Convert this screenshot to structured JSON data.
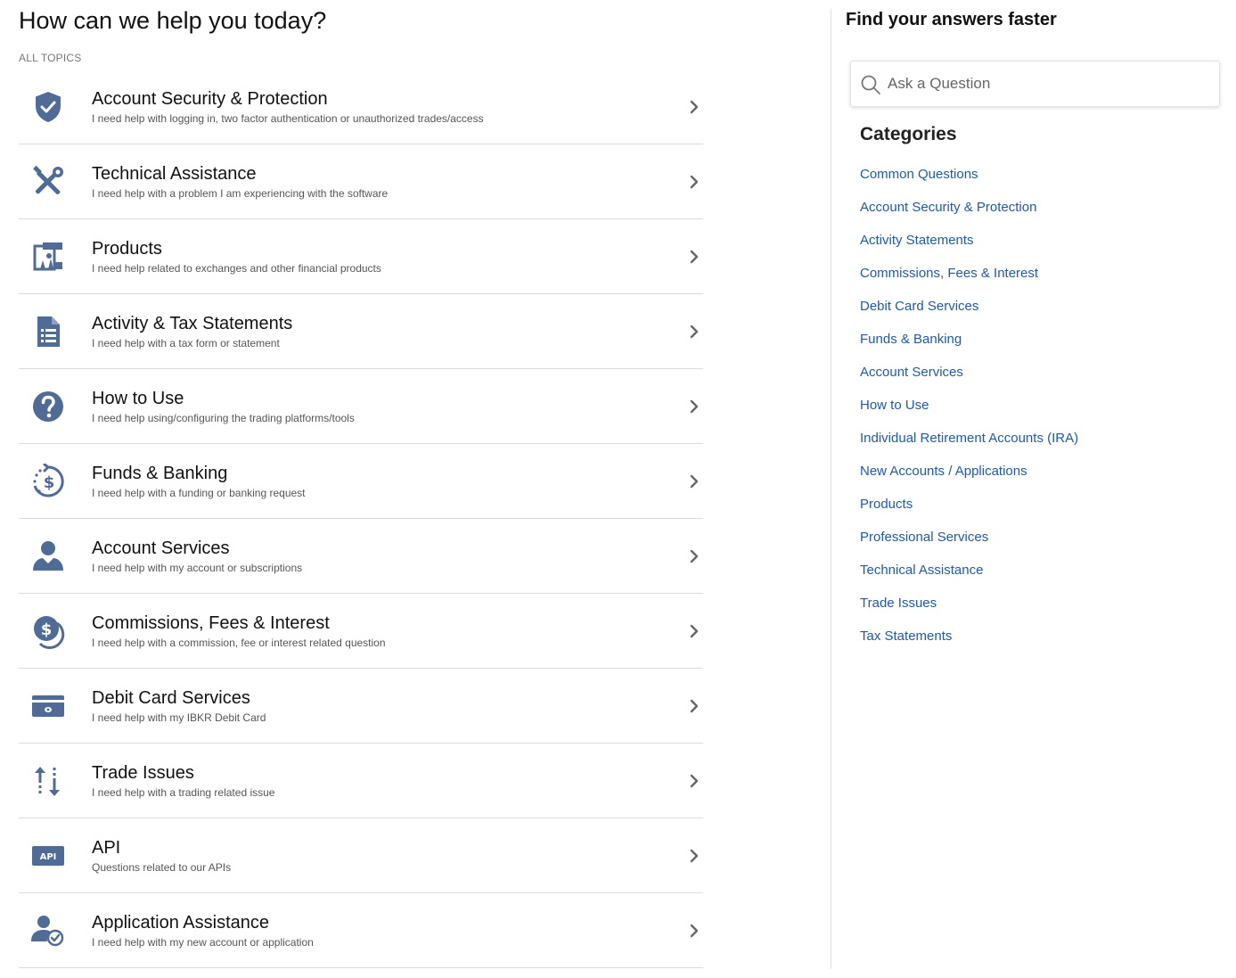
{
  "header": {
    "title": "How can we help you today?",
    "all_topics_label": "ALL TOPICS"
  },
  "colors": {
    "icon": "#4f6b96",
    "link": "#1f5aa8",
    "chevron": "#666666"
  },
  "topics": [
    {
      "title": "Account Security & Protection",
      "description": "I need help with logging in, two factor authentication or unauthorized trades/access",
      "icon": "shield-check-icon"
    },
    {
      "title": "Technical Assistance",
      "description": "I need help with a problem I am experiencing with the software",
      "icon": "tools-icon"
    },
    {
      "title": "Products",
      "description": "I need help related to exchanges and other financial products",
      "icon": "products-icon"
    },
    {
      "title": "Activity & Tax Statements",
      "description": "I need help with a tax form or statement",
      "icon": "document-list-icon"
    },
    {
      "title": "How to Use",
      "description": "I need help using/configuring the trading platforms/tools",
      "icon": "question-circle-icon"
    },
    {
      "title": "Funds & Banking",
      "description": "I need help with a funding or banking request",
      "icon": "dollar-refresh-icon"
    },
    {
      "title": "Account Services",
      "description": "I need help with my account or subscriptions",
      "icon": "user-icon"
    },
    {
      "title": "Commissions, Fees & Interest",
      "description": "I need help with a commission, fee or interest related question",
      "icon": "dollar-coin-icon"
    },
    {
      "title": "Debit Card Services",
      "description": "I need help with my IBKR Debit Card",
      "icon": "debit-card-icon"
    },
    {
      "title": "Trade Issues",
      "description": "I need help with a trading related issue",
      "icon": "trade-arrows-icon"
    },
    {
      "title": "API",
      "description": "Questions related to our APIs",
      "icon": "api-icon",
      "icon_text": "API"
    },
    {
      "title": "Application Assistance",
      "description": "I need help with my new account or application",
      "icon": "user-check-icon"
    }
  ],
  "sidebar": {
    "title": "Find your answers faster",
    "search_placeholder": "Ask a Question",
    "categories_heading": "Categories",
    "categories": [
      "Common Questions",
      "Account Security & Protection",
      "Activity Statements",
      "Commissions, Fees & Interest",
      "Debit Card Services",
      "Funds & Banking",
      "Account Services",
      "How to Use",
      "Individual Retirement Accounts (IRA)",
      "New Accounts / Applications",
      "Products",
      "Professional Services",
      "Technical Assistance",
      "Trade Issues",
      "Tax Statements"
    ]
  }
}
